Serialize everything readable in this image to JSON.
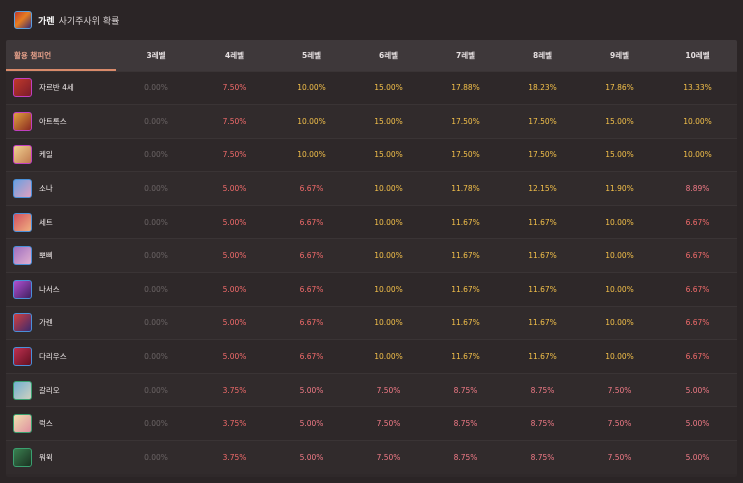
{
  "header": {
    "title": "가렌",
    "subtitle": "사기주사위 확률"
  },
  "table": {
    "columns": [
      "활용 챔피언",
      "3레벨",
      "4레벨",
      "5레벨",
      "6레벨",
      "7레벨",
      "8레벨",
      "9레벨",
      "10레벨"
    ],
    "rows": [
      {
        "name": "자르반 4세",
        "icon": "jarvan-icon",
        "colors": [
          "#c0392b",
          "#7a1b2a"
        ],
        "border": "#c040c0",
        "values": [
          "0.00%",
          "7.50%",
          "10.00%",
          "15.00%",
          "17.88%",
          "18.23%",
          "17.86%",
          "13.33%"
        ],
        "tones": [
          "zero",
          "red",
          "yellow",
          "yellow",
          "yellow",
          "yellow",
          "yellow",
          "yellow"
        ]
      },
      {
        "name": "아트록스",
        "icon": "aatrox-icon",
        "colors": [
          "#e0a040",
          "#8a2a20"
        ],
        "border": "#c040c0",
        "values": [
          "0.00%",
          "7.50%",
          "10.00%",
          "15.00%",
          "17.50%",
          "17.50%",
          "15.00%",
          "10.00%"
        ],
        "tones": [
          "zero",
          "red",
          "yellow",
          "yellow",
          "yellow",
          "yellow",
          "yellow",
          "yellow"
        ]
      },
      {
        "name": "케일",
        "icon": "kayle-icon",
        "colors": [
          "#f0d090",
          "#c07a50"
        ],
        "border": "#c040c0",
        "values": [
          "0.00%",
          "7.50%",
          "10.00%",
          "15.00%",
          "17.50%",
          "17.50%",
          "15.00%",
          "10.00%"
        ],
        "tones": [
          "zero",
          "red",
          "yellow",
          "yellow",
          "yellow",
          "yellow",
          "yellow",
          "yellow"
        ]
      },
      {
        "name": "소나",
        "icon": "sona-icon",
        "colors": [
          "#6aa0e0",
          "#e0a0c0"
        ],
        "border": "#4a90d9",
        "values": [
          "0.00%",
          "5.00%",
          "6.67%",
          "10.00%",
          "11.78%",
          "12.15%",
          "11.90%",
          "8.89%"
        ],
        "tones": [
          "zero",
          "red",
          "red",
          "yellow",
          "yellow",
          "yellow",
          "yellow",
          "pink"
        ]
      },
      {
        "name": "세트",
        "icon": "sett-icon",
        "colors": [
          "#d05060",
          "#f0b080"
        ],
        "border": "#4a90d9",
        "values": [
          "0.00%",
          "5.00%",
          "6.67%",
          "10.00%",
          "11.67%",
          "11.67%",
          "10.00%",
          "6.67%"
        ],
        "tones": [
          "zero",
          "red",
          "red",
          "yellow",
          "yellow",
          "yellow",
          "yellow",
          "red"
        ]
      },
      {
        "name": "뽀삐",
        "icon": "poppy-icon",
        "colors": [
          "#a070c0",
          "#e0b0d0"
        ],
        "border": "#4a90d9",
        "values": [
          "0.00%",
          "5.00%",
          "6.67%",
          "10.00%",
          "11.67%",
          "11.67%",
          "10.00%",
          "6.67%"
        ],
        "tones": [
          "zero",
          "red",
          "red",
          "yellow",
          "yellow",
          "yellow",
          "yellow",
          "red"
        ]
      },
      {
        "name": "나서스",
        "icon": "nasus-icon",
        "colors": [
          "#b050d0",
          "#402060"
        ],
        "border": "#4a90d9",
        "values": [
          "0.00%",
          "5.00%",
          "6.67%",
          "10.00%",
          "11.67%",
          "11.67%",
          "10.00%",
          "6.67%"
        ],
        "tones": [
          "zero",
          "red",
          "red",
          "yellow",
          "yellow",
          "yellow",
          "yellow",
          "red"
        ]
      },
      {
        "name": "가렌",
        "icon": "garen-icon",
        "colors": [
          "#d04040",
          "#3b2a6e"
        ],
        "border": "#4a90d9",
        "values": [
          "0.00%",
          "5.00%",
          "6.67%",
          "10.00%",
          "11.67%",
          "11.67%",
          "10.00%",
          "6.67%"
        ],
        "tones": [
          "zero",
          "red",
          "red",
          "yellow",
          "yellow",
          "yellow",
          "yellow",
          "red"
        ]
      },
      {
        "name": "다리우스",
        "icon": "darius-icon",
        "colors": [
          "#c03050",
          "#601020"
        ],
        "border": "#4a90d9",
        "values": [
          "0.00%",
          "5.00%",
          "6.67%",
          "10.00%",
          "11.67%",
          "11.67%",
          "10.00%",
          "6.67%"
        ],
        "tones": [
          "zero",
          "red",
          "red",
          "yellow",
          "yellow",
          "yellow",
          "yellow",
          "red"
        ]
      },
      {
        "name": "갈리오",
        "icon": "galio-icon",
        "colors": [
          "#70b0d0",
          "#d0d0c0"
        ],
        "border": "#3aa070",
        "values": [
          "0.00%",
          "3.75%",
          "5.00%",
          "7.50%",
          "8.75%",
          "8.75%",
          "7.50%",
          "5.00%"
        ],
        "tones": [
          "zero",
          "red",
          "pink",
          "pink",
          "pink",
          "pink",
          "pink",
          "pink"
        ]
      },
      {
        "name": "럭스",
        "icon": "lux-icon",
        "colors": [
          "#f0e0b0",
          "#e090a0"
        ],
        "border": "#3aa070",
        "values": [
          "0.00%",
          "3.75%",
          "5.00%",
          "7.50%",
          "8.75%",
          "8.75%",
          "7.50%",
          "5.00%"
        ],
        "tones": [
          "zero",
          "red",
          "pink",
          "pink",
          "pink",
          "pink",
          "pink",
          "pink"
        ]
      },
      {
        "name": "워윅",
        "icon": "warwick-icon",
        "colors": [
          "#3a8050",
          "#1a3020"
        ],
        "border": "#3aa070",
        "values": [
          "0.00%",
          "3.75%",
          "5.00%",
          "7.50%",
          "8.75%",
          "8.75%",
          "7.50%",
          "5.00%"
        ],
        "tones": [
          "zero",
          "red",
          "pink",
          "pink",
          "pink",
          "pink",
          "pink",
          "pink"
        ]
      }
    ]
  }
}
